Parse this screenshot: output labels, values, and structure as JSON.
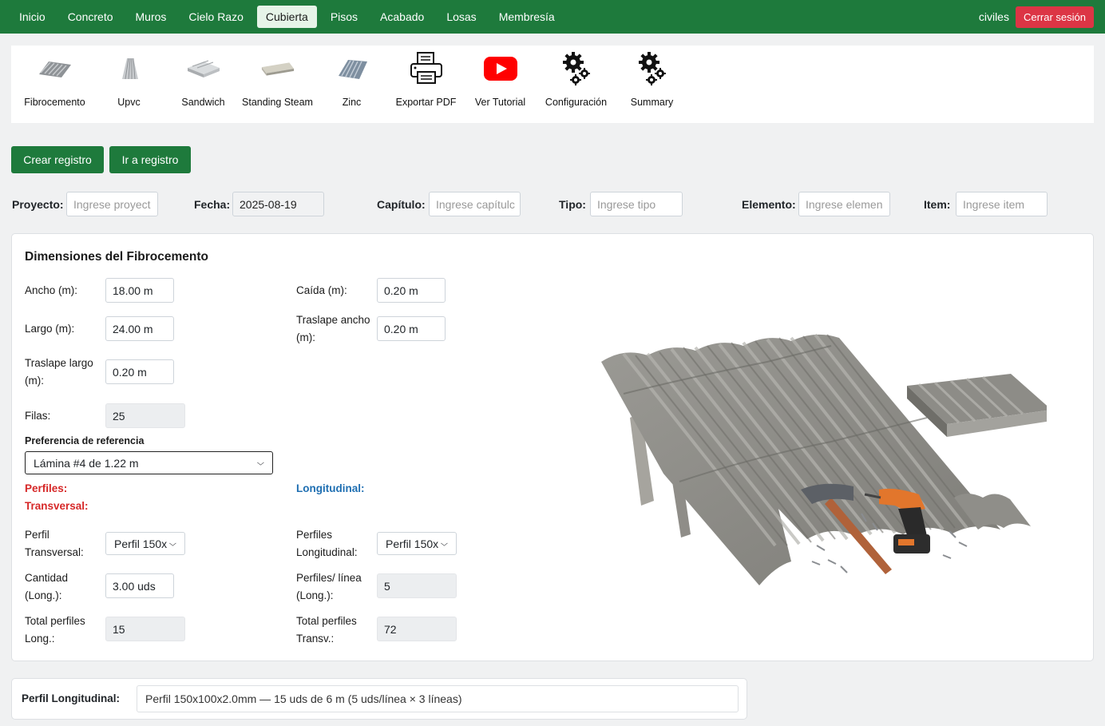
{
  "navbar": {
    "links": [
      "Inicio",
      "Concreto",
      "Muros",
      "Cielo Razo",
      "Cubierta",
      "Pisos",
      "Acabado",
      "Losas",
      "Membresía"
    ],
    "active": "Cubierta",
    "username": "civiles",
    "logout_label": "Cerrar sesión"
  },
  "toolbar": {
    "items": [
      {
        "label": "Fibrocemento",
        "icon": "corrugated-sheet-icon"
      },
      {
        "label": "Upvc",
        "icon": "upvc-sheet-icon"
      },
      {
        "label": "Sandwich",
        "icon": "sandwich-panel-icon"
      },
      {
        "label": "Standing Steam",
        "icon": "standing-seam-icon"
      },
      {
        "label": "Zinc",
        "icon": "zinc-sheet-icon"
      },
      {
        "label": "Exportar PDF",
        "icon": "printer-icon"
      },
      {
        "label": "Ver Tutorial",
        "icon": "youtube-icon"
      },
      {
        "label": "Configuración",
        "icon": "gear-icon"
      },
      {
        "label": "Summary",
        "icon": "gear-icon"
      }
    ]
  },
  "actions": {
    "create": "Crear registro",
    "goto": "Ir a registro"
  },
  "meta": {
    "proyecto_label": "Proyecto:",
    "proyecto_placeholder": "Ingrese proyect",
    "fecha_label": "Fecha:",
    "fecha_value": "2025-08-19",
    "capitulo_label": "Capítulo:",
    "capitulo_placeholder": "Ingrese capítulc",
    "tipo_label": "Tipo:",
    "tipo_placeholder": "Ingrese tipo",
    "elemento_label": "Elemento:",
    "elemento_placeholder": "Ingrese elemen",
    "item_label": "Item:",
    "item_placeholder": "Ingrese item"
  },
  "dimensions": {
    "title": "Dimensiones del Fibrocemento",
    "ancho_label": "Ancho (m):",
    "ancho_value": "18.00 m",
    "largo_label": "Largo (m):",
    "largo_value": "24.00 m",
    "traslape_largo_label": "Traslape largo (m):",
    "traslape_largo_value": "0.20 m",
    "filas_label": "Filas:",
    "filas_value": "25",
    "caida_label": "Caída (m):",
    "caida_value": "0.20 m",
    "traslape_ancho_label": "Traslape ancho (m):",
    "traslape_ancho_value": "0.20 m",
    "preferencia_label": "Preferencia de referencia",
    "preferencia_value": "Lámina #4 de 1.22 m"
  },
  "perfiles": {
    "transversal_heading": "Perfiles: Transversal:",
    "longitudinal_heading": "Longitudinal:",
    "perfil_transversal_label": "Perfil Transversal:",
    "perfil_transversal_value": "Perfil 150x",
    "cantidad_label": "Cantidad (Long.):",
    "cantidad_value": "3.00 uds",
    "total_long_label": "Total perfiles Long.:",
    "total_long_value": "15",
    "perfiles_long_label": "Perfiles Longitudinal:",
    "perfiles_long_value": "Perfil 150x",
    "perfiles_linea_label": "Perfiles/ línea (Long.):",
    "perfiles_linea_value": "5",
    "total_transv_label": "Total perfiles Transv.:",
    "total_transv_value": "72"
  },
  "summary": {
    "label": "Perfil Longitudinal:",
    "value": "Perfil 150x100x2.0mm — 15 uds de 6 m (5 uds/línea × 3 líneas)"
  },
  "colors": {
    "brand_green": "#1e7a3c",
    "danger_red": "#dc3545",
    "heading_red": "#d62828",
    "heading_blue": "#1f6fb2"
  }
}
